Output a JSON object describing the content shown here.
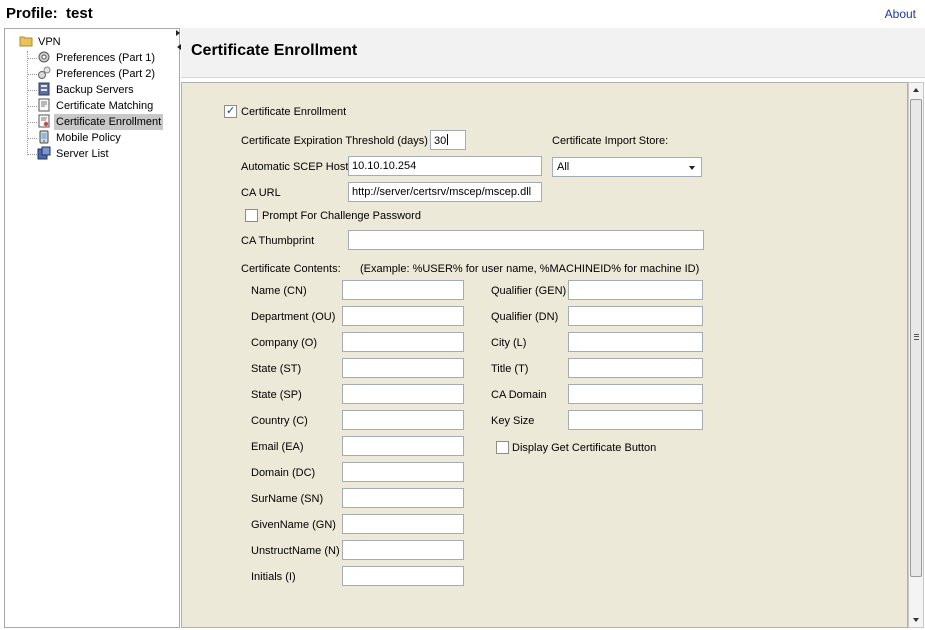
{
  "window": {
    "profile_label": "Profile:",
    "profile_name": "test",
    "about_label": "About"
  },
  "tree": {
    "root": "VPN",
    "items": [
      {
        "label": "Preferences (Part 1)",
        "icon": "gear-icon"
      },
      {
        "label": "Preferences (Part 2)",
        "icon": "gears-icon"
      },
      {
        "label": "Backup Servers",
        "icon": "server-icon"
      },
      {
        "label": "Certificate Matching",
        "icon": "certificate-icon"
      },
      {
        "label": "Certificate Enrollment",
        "icon": "certificate-enroll-icon",
        "selected": true
      },
      {
        "label": "Mobile Policy",
        "icon": "mobile-icon"
      },
      {
        "label": "Server List",
        "icon": "server-list-icon"
      }
    ]
  },
  "page": {
    "title": "Certificate Enrollment"
  },
  "form": {
    "enrollment_label": "Certificate Enrollment",
    "enrollment_checked": true,
    "threshold_label": "Certificate Expiration Threshold (days)",
    "threshold_value": "30",
    "import_store_label": "Certificate Import Store:",
    "import_store_value": "All",
    "scep_host_label": "Automatic SCEP Host",
    "scep_host_value": "10.10.10.254",
    "ca_url_label": "CA URL",
    "ca_url_value": "http://server/certsrv/mscep/mscep.dll",
    "challenge_label": "Prompt For Challenge Password",
    "challenge_checked": false,
    "thumbprint_label": "CA Thumbprint",
    "thumbprint_value": "",
    "contents_label": "Certificate Contents:",
    "contents_hint": "(Example: %USER% for user name, %MACHINEID% for machine ID)",
    "left_fields": [
      {
        "label": "Name (CN)",
        "value": ""
      },
      {
        "label": "Department (OU)",
        "value": ""
      },
      {
        "label": "Company (O)",
        "value": ""
      },
      {
        "label": "State (ST)",
        "value": ""
      },
      {
        "label": "State (SP)",
        "value": ""
      },
      {
        "label": "Country (C)",
        "value": ""
      },
      {
        "label": "Email (EA)",
        "value": ""
      },
      {
        "label": "Domain (DC)",
        "value": ""
      },
      {
        "label": "SurName (SN)",
        "value": ""
      },
      {
        "label": "GivenName (GN)",
        "value": ""
      },
      {
        "label": "UnstructName (N)",
        "value": ""
      },
      {
        "label": "Initials (I)",
        "value": ""
      }
    ],
    "right_fields": [
      {
        "label": "Qualifier (GEN)",
        "value": ""
      },
      {
        "label": "Qualifier (DN)",
        "value": ""
      },
      {
        "label": "City (L)",
        "value": ""
      },
      {
        "label": "Title (T)",
        "value": ""
      },
      {
        "label": "CA Domain",
        "value": ""
      },
      {
        "label": "Key Size",
        "value": ""
      }
    ],
    "display_button_label": "Display Get Certificate Button",
    "display_button_checked": false
  }
}
